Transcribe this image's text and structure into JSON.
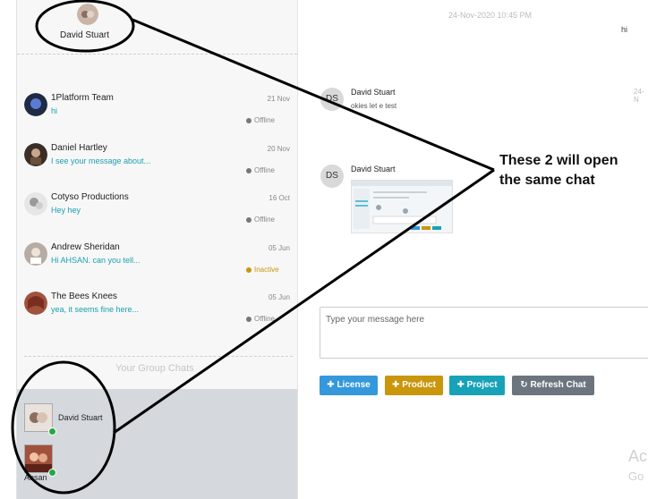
{
  "current_user": {
    "name": "David Stuart"
  },
  "contacts": [
    {
      "name": "1Platform Team",
      "message": "hi",
      "date": "21 Nov",
      "status": "Offline",
      "status_color": "#777777"
    },
    {
      "name": "Daniel Hartley",
      "message": "I see your message about...",
      "date": "20 Nov",
      "status": "Offline",
      "status_color": "#777777"
    },
    {
      "name": "Cotyso Productions",
      "message": "Hey hey",
      "date": "16 Oct",
      "status": "Offline",
      "status_color": "#777777"
    },
    {
      "name": "Andrew Sheridan",
      "message": "Hi AHSAN. can you tell...",
      "date": "05 Jun",
      "status": "Inactive",
      "status_color": "#c9960c"
    },
    {
      "name": "The Bees Knees",
      "message": "yea, it seems fine here...",
      "date": "05 Jun",
      "status": "Offline",
      "status_color": "#777777"
    }
  ],
  "group_section_title": "Your Group Chats",
  "group_items": [
    {
      "name": "David Stuart"
    },
    {
      "name": "Ahsan"
    }
  ],
  "chat": {
    "top_timestamp": "24-Nov-2020 10:45 PM",
    "top_message": "hi",
    "messages": [
      {
        "initials": "DS",
        "sender": "David Stuart",
        "text": "okies let e test",
        "side_ts": "24-N"
      },
      {
        "initials": "DS",
        "sender": "David Stuart",
        "text": "",
        "side_ts": ""
      }
    ],
    "input_placeholder": "Type your message here",
    "buttons": {
      "license": "License",
      "product": "Product",
      "project": "Project",
      "refresh": "Refresh Chat"
    },
    "watermark_line1": "Ac",
    "watermark_line2": "Go"
  },
  "annotation": {
    "line1": "These 2 will open",
    "line2": "the same chat"
  },
  "icons": {
    "plus": "plus-icon",
    "refresh": "refresh-icon"
  },
  "colors": {
    "online": "#28a745",
    "link_text": "#1aa1b0",
    "license": "#3498db",
    "product": "#c9960c",
    "project": "#17a2b8",
    "refresh": "#6c757d"
  }
}
